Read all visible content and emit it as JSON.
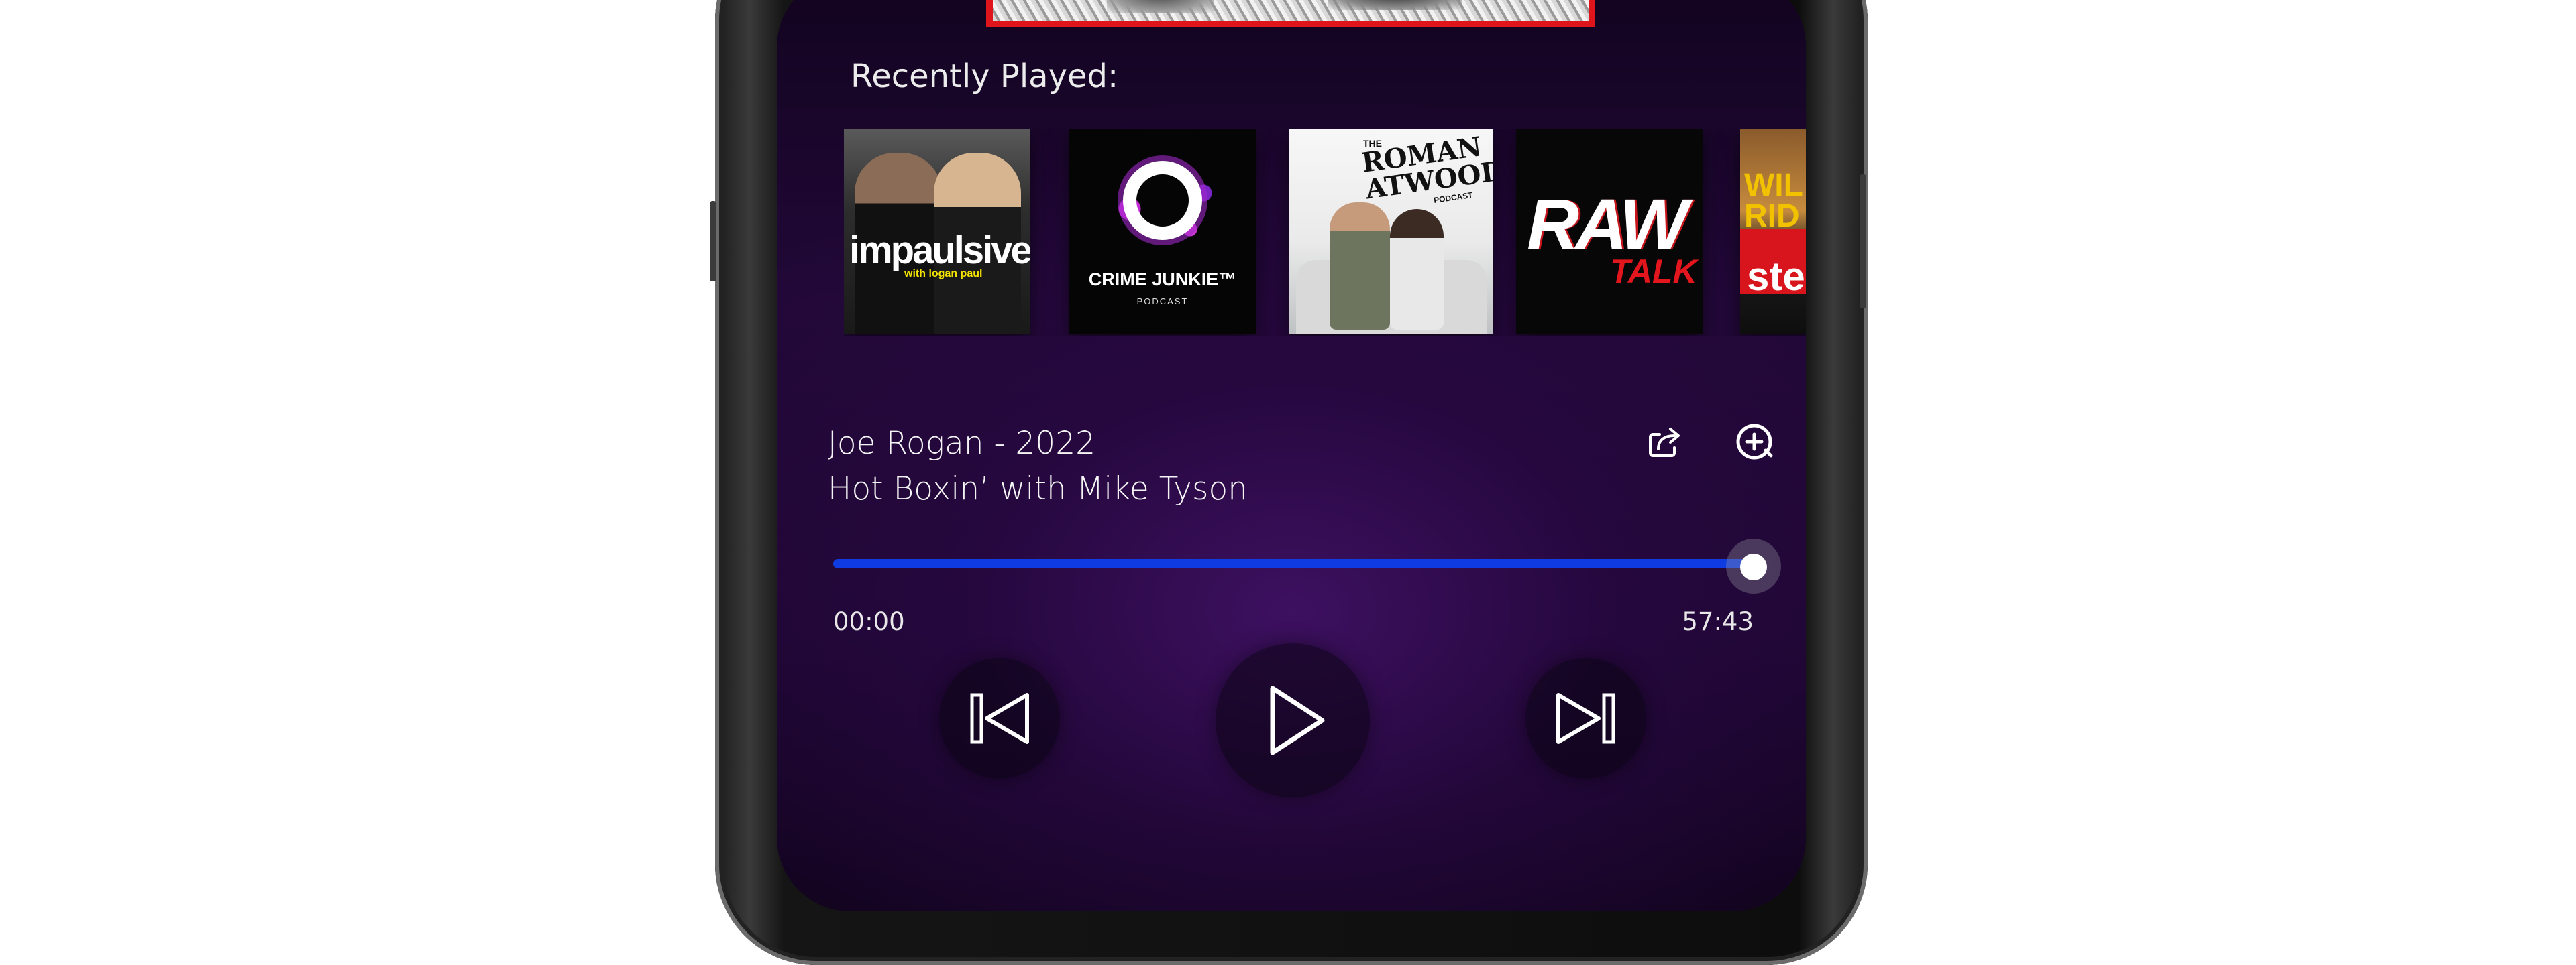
{
  "recently_played": {
    "title": "Recently Played:",
    "items": [
      {
        "title": "impaulsive",
        "subtitle": "with logan paul"
      },
      {
        "title": "CRIME JUNKIE™",
        "subtitle": "PODCAST"
      },
      {
        "title": "ROMAN ATWOOD",
        "top": "THE",
        "bottom": "PODCAST"
      },
      {
        "title": "RAW",
        "subtitle": "TALK"
      },
      {
        "title": "WIL RID",
        "subtitle": "ste"
      }
    ]
  },
  "now_playing": {
    "artist_line": "Joe Rogan - 2022",
    "episode_title": "Hot Boxin’ with Mike Tyson",
    "elapsed": "00:00",
    "duration": "57:43",
    "progress": 1.0,
    "progress_color": "#0f3be3"
  },
  "icons": {
    "share": "share-icon",
    "add": "add-circle-icon",
    "previous": "skip-previous-icon",
    "play": "play-icon",
    "next": "skip-next-icon"
  }
}
